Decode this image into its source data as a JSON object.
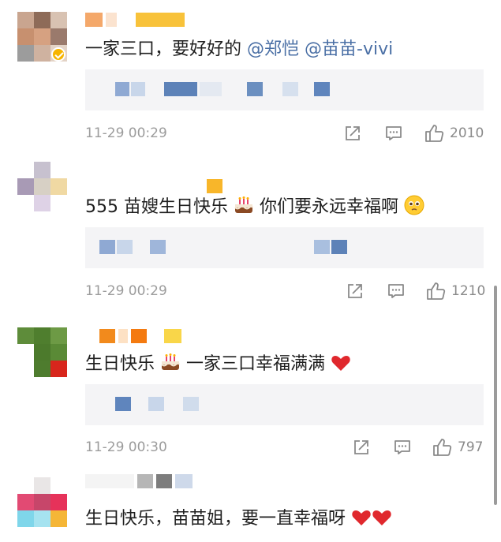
{
  "comments": [
    {
      "text_plain": "一家三口，要好好的",
      "mention1": "@郑恺",
      "mention2": "@苗苗-vivi",
      "time": "11-29 00:29",
      "likes": "2010"
    },
    {
      "text_a": "555 苗嫂生日快乐",
      "text_b": "你们要永远幸福啊",
      "time": "11-29 00:29",
      "likes": "1210"
    },
    {
      "text_a": "生日快乐",
      "text_b": "一家三口幸福满满",
      "time": "11-29 00:30",
      "likes": "797"
    },
    {
      "text_a": "生日快乐，苗苗姐，要一直幸福呀"
    }
  ],
  "icons": {
    "share": "share-icon",
    "comment": "comment-icon",
    "like": "thumbs-up-icon",
    "cake": "birthday-cake-emoji",
    "heart": "red-heart-emoji",
    "face": "pleading-face-emoji",
    "verified": "verified-badge-icon"
  },
  "colors": {
    "mention": "#4a6fa5",
    "meta_text": "#9c9c9c",
    "reply_bg": "#f4f4f6",
    "verified": "#f7b500",
    "heart": "#e0282d"
  }
}
